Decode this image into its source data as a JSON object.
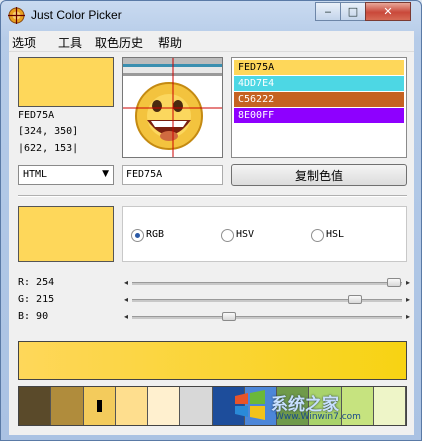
{
  "window": {
    "title": "Just Color Picker",
    "minimize": "‒",
    "maximize": "□",
    "close": "✕"
  },
  "menu": [
    "选项",
    "工具",
    "取色历史",
    "帮助"
  ],
  "current": {
    "hex": "FED75A",
    "color": "#fed75a",
    "pos1": "[324, 350]",
    "pos2": "|622, 153|"
  },
  "history": [
    {
      "label": "FED75A",
      "color": "#fed75a",
      "text": "#000000"
    },
    {
      "label": "4DD7E4",
      "color": "#4dd7e4",
      "text": "#ffffff"
    },
    {
      "label": "C56222",
      "color": "#c56222",
      "text": "#ffffff"
    },
    {
      "label": "8E00FF",
      "color": "#8e00ff",
      "text": "#ffffff"
    }
  ],
  "format": {
    "selected": "HTML",
    "value": "FED75A",
    "copy_label": "复制色值"
  },
  "modes": {
    "rgb": "RGB",
    "hsv": "HSV",
    "hsl": "HSL",
    "selected": "rgb"
  },
  "sliders": {
    "r": {
      "label": "R: 254",
      "value": 254
    },
    "g": {
      "label": "G: 215",
      "value": 215
    },
    "b": {
      "label": "B: 90",
      "value": 90
    }
  },
  "gradient": {
    "from": "#fed75a",
    "to": "#f7d313"
  },
  "swatches": [
    "#5a4a2a",
    "#b08c3c",
    "#f3cb5c",
    "#fede8e",
    "#fff0cf",
    "#d8d8d8",
    "#1d4d9b",
    "#4c86d8",
    "#6f9a4a",
    "#a9d36b",
    "#c6e37f",
    "#eef5c8"
  ],
  "watermark": {
    "text": "系统之家",
    "url": "Www.Winwin7.com"
  }
}
